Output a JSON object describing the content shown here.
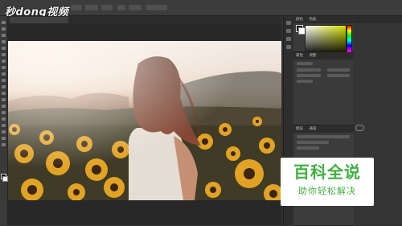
{
  "watermark": {
    "text": "秒dong视频"
  },
  "document": {
    "tab_label": ""
  },
  "options_bar": {
    "labels": [
      "",
      "",
      "",
      "",
      ""
    ]
  },
  "panels": {
    "color": {
      "tabs": [
        "颜色",
        "色板"
      ]
    },
    "properties": {
      "tabs": [
        "属性",
        "调整"
      ],
      "title": ""
    },
    "layers": {
      "tabs": [
        "图层",
        "通道"
      ]
    },
    "right_column": {
      "header": ""
    },
    "cloud_text": [
      "",
      ""
    ]
  },
  "brand": {
    "main": "百科全说",
    "sub": "助你轻松解决"
  },
  "colors": {
    "brand_green": "#3db23f",
    "canvas_dark": "#282828",
    "panel": "#3a3a3a"
  }
}
